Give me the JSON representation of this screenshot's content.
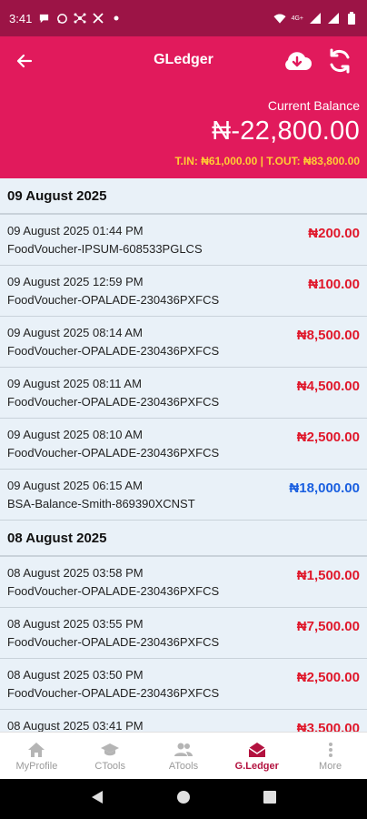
{
  "status_bar": {
    "time": "3:41",
    "network": "4G+"
  },
  "header": {
    "title": "GLedger",
    "current_balance_label": "Current Balance",
    "current_balance": "₦-22,800.00",
    "totals": "T.IN: ₦61,000.00 | T.OUT: ₦83,800.00"
  },
  "groups": [
    {
      "date": "09 August 2025",
      "transactions": [
        {
          "datetime": "09 August 2025 01:44 PM",
          "description": "FoodVoucher-IPSUM-608533PGLCS",
          "amount": "₦200.00",
          "type": "debit"
        },
        {
          "datetime": "09 August 2025 12:59 PM",
          "description": "FoodVoucher-OPALADE-230436PXFCS",
          "amount": "₦100.00",
          "type": "debit"
        },
        {
          "datetime": "09 August 2025 08:14 AM",
          "description": "FoodVoucher-OPALADE-230436PXFCS",
          "amount": "₦8,500.00",
          "type": "debit"
        },
        {
          "datetime": "09 August 2025 08:11 AM",
          "description": "FoodVoucher-OPALADE-230436PXFCS",
          "amount": "₦4,500.00",
          "type": "debit"
        },
        {
          "datetime": "09 August 2025 08:10 AM",
          "description": "FoodVoucher-OPALADE-230436PXFCS",
          "amount": "₦2,500.00",
          "type": "debit"
        },
        {
          "datetime": "09 August 2025 06:15 AM",
          "description": "BSA-Balance-Smith-869390XCNST",
          "amount": "₦18,000.00",
          "type": "credit"
        }
      ]
    },
    {
      "date": "08 August 2025",
      "transactions": [
        {
          "datetime": "08 August 2025 03:58 PM",
          "description": "FoodVoucher-OPALADE-230436PXFCS",
          "amount": "₦1,500.00",
          "type": "debit"
        },
        {
          "datetime": "08 August 2025 03:55 PM",
          "description": "FoodVoucher-OPALADE-230436PXFCS",
          "amount": "₦7,500.00",
          "type": "debit"
        },
        {
          "datetime": "08 August 2025 03:50 PM",
          "description": "FoodVoucher-OPALADE-230436PXFCS",
          "amount": "₦2,500.00",
          "type": "debit"
        },
        {
          "datetime": "08 August 2025 03:41 PM",
          "description": "",
          "amount": "₦3,500.00",
          "type": "debit"
        }
      ]
    }
  ],
  "bottom_nav": [
    {
      "label": "MyProfile",
      "icon": "home-icon",
      "active": false
    },
    {
      "label": "CTools",
      "icon": "graduation-cap-icon",
      "active": false
    },
    {
      "label": "ATools",
      "icon": "people-icon",
      "active": false
    },
    {
      "label": "G.Ledger",
      "icon": "envelope-open-icon",
      "active": true
    },
    {
      "label": "More",
      "icon": "more-vertical-icon",
      "active": false
    }
  ],
  "colors": {
    "header": "#e11a5c",
    "status_bar": "#9c1446",
    "debit": "#e0182b",
    "credit": "#1a5fe0",
    "totals": "#ffcc33",
    "active_nav": "#b3123f"
  }
}
